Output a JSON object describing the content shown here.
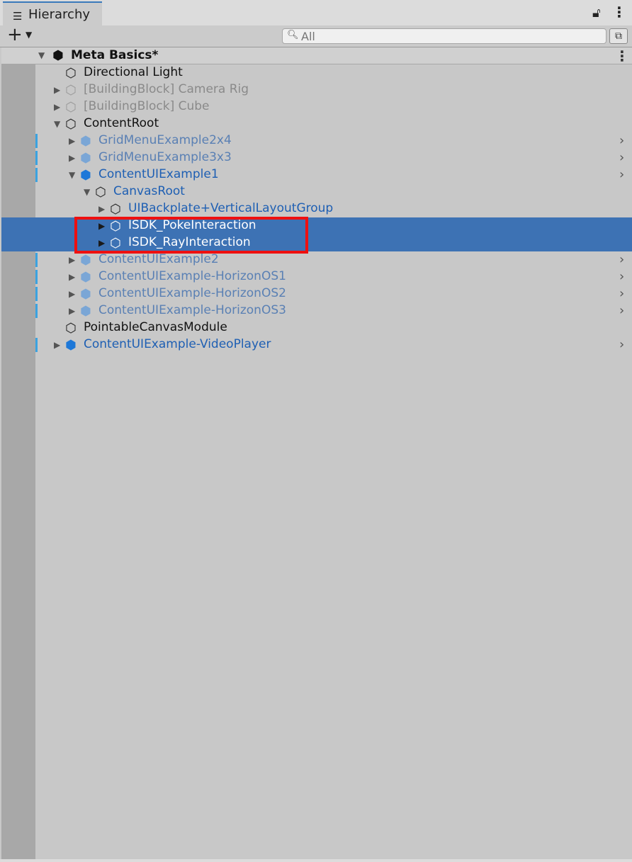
{
  "tab": {
    "label": "Hierarchy",
    "icon": "list-icon"
  },
  "toolbar": {
    "add_label": "+",
    "search_placeholder": "All"
  },
  "scene": {
    "name": "Meta Basics*"
  },
  "rows": [
    {
      "label": "Directional Light",
      "style": "black",
      "icon": "gameobject-icon",
      "expanded": null,
      "selected": false,
      "prefab_stripe": false,
      "chevron": false
    },
    {
      "label": "[BuildingBlock] Camera Rig",
      "style": "gray",
      "icon": "gameobject-icon",
      "expanded": false,
      "selected": false,
      "prefab_stripe": false,
      "chevron": false
    },
    {
      "label": "[BuildingBlock] Cube",
      "style": "gray",
      "icon": "gameobject-icon",
      "expanded": false,
      "selected": false,
      "prefab_stripe": false,
      "chevron": false
    },
    {
      "label": "ContentRoot",
      "style": "black",
      "icon": "gameobject-icon",
      "expanded": true,
      "selected": false,
      "prefab_stripe": false,
      "chevron": false
    },
    {
      "label": "GridMenuExample2x4",
      "style": "blue-faded",
      "icon": "prefab-icon",
      "expanded": false,
      "selected": false,
      "prefab_stripe": true,
      "chevron": true
    },
    {
      "label": "GridMenuExample3x3",
      "style": "blue-faded",
      "icon": "prefab-icon",
      "expanded": false,
      "selected": false,
      "prefab_stripe": true,
      "chevron": true
    },
    {
      "label": "ContentUIExample1",
      "style": "blue",
      "icon": "prefab-icon",
      "expanded": true,
      "selected": false,
      "prefab_stripe": true,
      "chevron": true
    },
    {
      "label": "CanvasRoot",
      "style": "blue",
      "icon": "gameobject-icon",
      "expanded": true,
      "selected": false,
      "prefab_stripe": false,
      "chevron": false
    },
    {
      "label": "UIBackplate+VerticalLayoutGroup",
      "style": "blue",
      "icon": "gameobject-icon",
      "expanded": false,
      "selected": false,
      "prefab_stripe": false,
      "chevron": false
    },
    {
      "label": "ISDK_PokeInteraction",
      "style": "white",
      "icon": "gameobject-icon",
      "expanded": false,
      "selected": true,
      "prefab_stripe": false,
      "chevron": false
    },
    {
      "label": "ISDK_RayInteraction",
      "style": "white",
      "icon": "gameobject-icon",
      "expanded": false,
      "selected": true,
      "prefab_stripe": false,
      "chevron": false
    },
    {
      "label": "ContentUIExample2",
      "style": "blue-faded",
      "icon": "prefab-icon",
      "expanded": false,
      "selected": false,
      "prefab_stripe": true,
      "chevron": true
    },
    {
      "label": "ContentUIExample-HorizonOS1",
      "style": "blue-faded",
      "icon": "prefab-icon",
      "expanded": false,
      "selected": false,
      "prefab_stripe": true,
      "chevron": true
    },
    {
      "label": "ContentUIExample-HorizonOS2",
      "style": "blue-faded",
      "icon": "prefab-icon",
      "expanded": false,
      "selected": false,
      "prefab_stripe": true,
      "chevron": true
    },
    {
      "label": "ContentUIExample-HorizonOS3",
      "style": "blue-faded",
      "icon": "prefab-icon",
      "expanded": false,
      "selected": false,
      "prefab_stripe": true,
      "chevron": true
    },
    {
      "label": "PointableCanvasModule",
      "style": "black",
      "icon": "gameobject-icon",
      "expanded": null,
      "selected": false,
      "prefab_stripe": false,
      "chevron": false
    },
    {
      "label": "ContentUIExample-VideoPlayer",
      "style": "blue",
      "icon": "prefab-icon",
      "expanded": false,
      "selected": false,
      "prefab_stripe": true,
      "chevron": true
    }
  ],
  "colors": {
    "selection": "#3d72b4",
    "prefab_blue": "#1e5fb3",
    "highlight_box": "#ee1010"
  }
}
